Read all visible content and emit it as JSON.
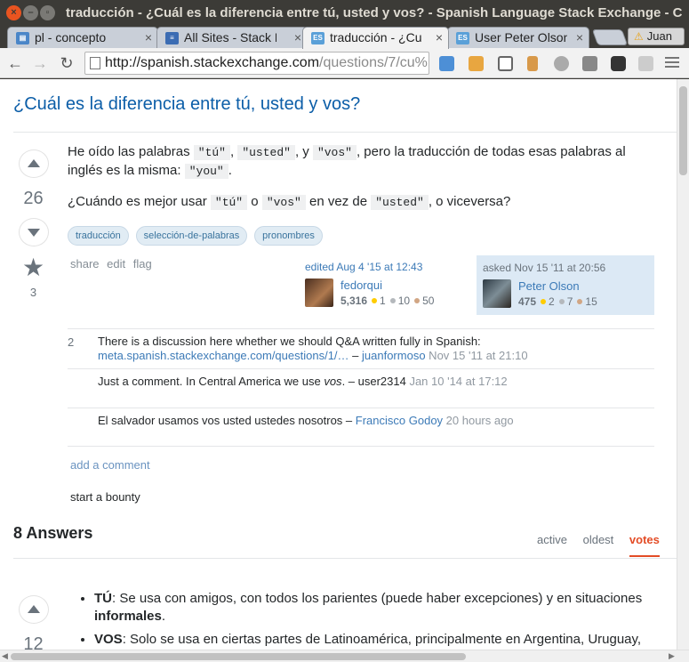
{
  "window": {
    "title": "traducción - ¿Cuál es la diferencia entre tú, usted y vos? - Spanish Language Stack Exchange - C",
    "profile_name": "Juan"
  },
  "tabs": [
    {
      "label": "pl - concepto",
      "favicon": "doc-icon",
      "color": "#4a86c8"
    },
    {
      "label": "All Sites - Stack E",
      "favicon": "stack-icon",
      "color": "#3b6cb3"
    },
    {
      "label": "traducción - ¿Cu",
      "favicon": "es-icon",
      "color": "#5aa0d8",
      "active": true
    },
    {
      "label": "User Peter Olson",
      "favicon": "es-icon",
      "color": "#5aa0d8"
    }
  ],
  "toolbar": {
    "url_host": "http://spanish.stackexchange.com",
    "url_path": "/questions/7/cu%"
  },
  "question": {
    "title": "¿Cuál es la diferencia entre tú, usted y vos?",
    "votes": "26",
    "favorites": "3",
    "p1_a": "He oído las palabras ",
    "code_tu": "\"tú\"",
    "sep1": ", ",
    "code_usted": "\"usted\"",
    "sep2": ", y ",
    "code_vos": "\"vos\"",
    "p1_b": ", pero la traducción de todas esas palabras al inglés es la misma: ",
    "code_you": "\"you\"",
    "p1_c": ".",
    "p2_a": "¿Cuándo es mejor usar ",
    "p2_b": " o ",
    "p2_c": " en vez de ",
    "p2_d": ", o viceversa?",
    "tags": [
      "traducción",
      "selección-de-palabras",
      "pronombres"
    ],
    "menu": {
      "share": "share",
      "edit": "edit",
      "flag": "flag"
    },
    "edited": {
      "action": "edited Aug 4 '15 at 12:43",
      "user": "fedorqui",
      "rep": "5,316",
      "gold": "1",
      "silver": "10",
      "bronze": "50"
    },
    "asked": {
      "action": "asked Nov 15 '11 at 20:56",
      "user": "Peter Olson",
      "rep": "475",
      "gold": "2",
      "silver": "7",
      "bronze": "15"
    }
  },
  "comments": [
    {
      "score": "2",
      "text": "There is a discussion here whether we should Q&A written fully in Spanish:",
      "link": "meta.spanish.stackexchange.com/questions/1/…",
      "dash": " – ",
      "user": "juanformoso",
      "date": " Nov 15 '11 at 21:10"
    },
    {
      "score": "",
      "text_a": "Just a comment. In Central America we use ",
      "text_em": "vos",
      "text_b": ". – user2314",
      "date": " Jan 10 '14 at 17:12"
    },
    {
      "score": "",
      "text": "El salvador usamos vos usted ustedes nosotros",
      "dash": " – ",
      "user": "Francisco Godoy",
      "date": " 20 hours ago"
    }
  ],
  "add_comment": "add a comment",
  "start_bounty": "start a bounty",
  "answers": {
    "header": "8 Answers",
    "sort": [
      "active",
      "oldest",
      "votes"
    ],
    "sort_active": "votes",
    "first_votes": "12",
    "items": [
      {
        "term": "TÚ",
        "text": ": Se usa con amigos, con todos los parientes (puede haber excepciones) y en situaciones ",
        "strong": "informales",
        "end": "."
      },
      {
        "term": "VOS",
        "text": ": Solo se usa en ciertas partes de Latinoamérica, principalmente en Argentina, Uruguay,"
      }
    ]
  }
}
